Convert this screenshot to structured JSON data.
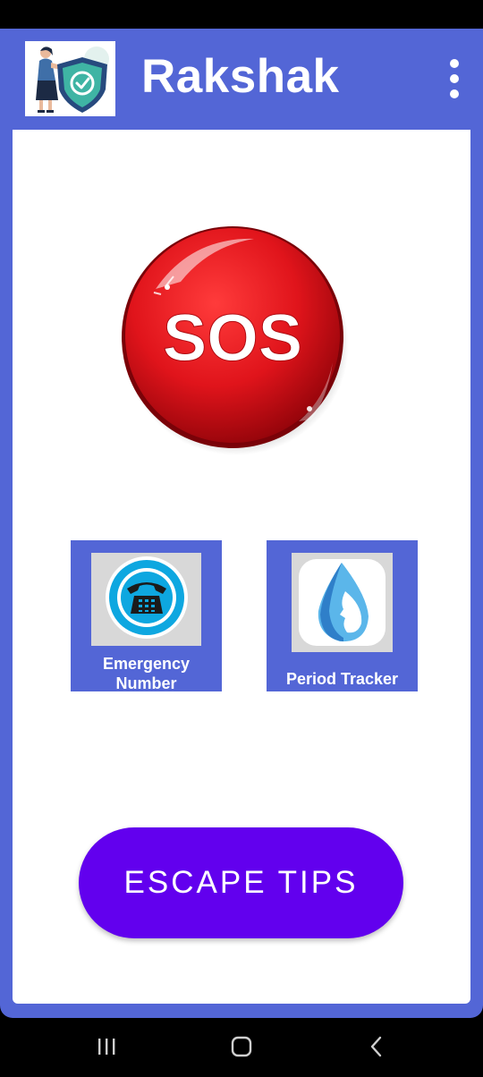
{
  "app": {
    "title": "Rakshak",
    "theme_color": "#5366D6"
  },
  "toolbar": {
    "logo_icon": "woman-shield-logo-icon",
    "overflow_icon": "more-vert-icon"
  },
  "sos": {
    "label": "SOS",
    "color": "#E0141B"
  },
  "tiles": [
    {
      "label": "Emergency Number",
      "icon": "telephone-icon",
      "icon_color": "#0EA7E0"
    },
    {
      "label": "Period Tracker",
      "icon": "water-drop-face-icon",
      "icon_color": "#4FA3DD"
    }
  ],
  "escape": {
    "label": "ESCAPE TIPS",
    "color": "#6200EE"
  },
  "navbar": {
    "recent_icon": "recent-apps-icon",
    "home_icon": "home-icon",
    "back_icon": "back-icon"
  }
}
